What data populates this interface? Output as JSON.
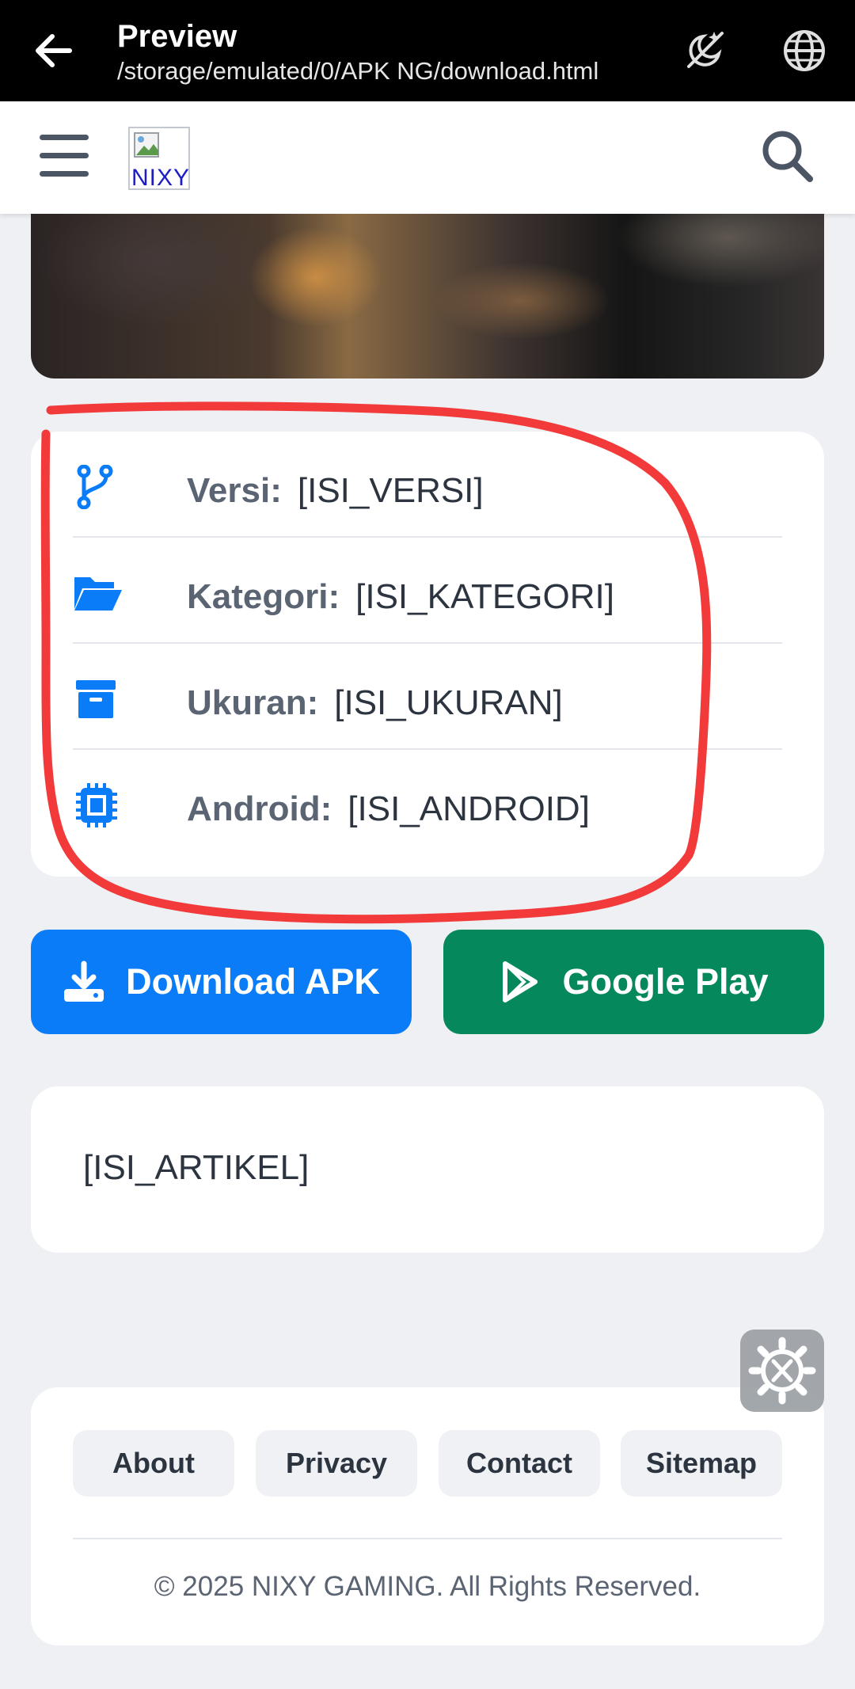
{
  "appbar": {
    "title": "Preview",
    "path": "/storage/emulated/0/APK NG/download.html",
    "icons": [
      "back-arrow-icon",
      "dark-mode-toggle-icon",
      "globe-icon"
    ]
  },
  "header": {
    "logo_alt": "NIXY",
    "icons": [
      "hamburger-menu-icon",
      "search-icon"
    ]
  },
  "info": {
    "items": [
      {
        "icon": "branch-icon",
        "label": "Versi:",
        "value": "[ISI_VERSI]"
      },
      {
        "icon": "folder-open-icon",
        "label": "Kategori:",
        "value": "[ISI_KATEGORI]"
      },
      {
        "icon": "archive-box-icon",
        "label": "Ukuran:",
        "value": "[ISI_UKURAN]"
      },
      {
        "icon": "chip-icon",
        "label": "Android:",
        "value": "[ISI_ANDROID]"
      }
    ]
  },
  "buttons": {
    "download": "Download APK",
    "google_play": "Google Play"
  },
  "article": {
    "text": "[ISI_ARTIKEL]"
  },
  "footer": {
    "links": [
      "About",
      "Privacy",
      "Contact",
      "Sitemap"
    ],
    "copyright": "© 2025 NIXY GAMING. All Rights Reserved."
  },
  "colors": {
    "accent_blue": "#0a7cf8",
    "play_green": "#05885c",
    "annotation_red": "#f23a3a"
  }
}
